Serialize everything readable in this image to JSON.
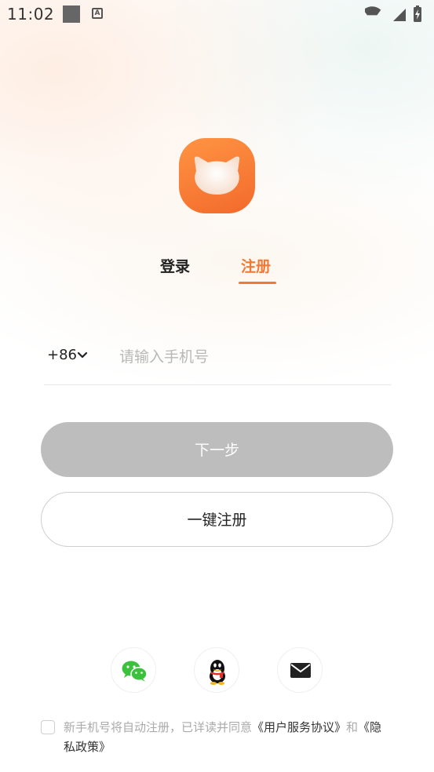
{
  "status_bar": {
    "time": "11:02",
    "icons": [
      "notification-square-icon",
      "a-notification-icon",
      "wifi-icon",
      "cell-signal-icon",
      "battery-charging-icon"
    ]
  },
  "logo": {
    "icon": "cat-head-icon",
    "color": "#f47a35"
  },
  "tabs": [
    {
      "label": "登录",
      "active": false
    },
    {
      "label": "注册",
      "active": true
    }
  ],
  "accent_color": "#f07a35",
  "phone": {
    "country_code": "+86",
    "placeholder": "请输入手机号",
    "value": ""
  },
  "buttons": {
    "next_label": "下一步",
    "one_key_register_label": "一键注册"
  },
  "social_login": [
    {
      "name": "wechat",
      "icon": "wechat-icon",
      "color": "#3cc13c"
    },
    {
      "name": "qq",
      "icon": "qq-penguin-icon",
      "color": "#111111"
    },
    {
      "name": "email",
      "icon": "mail-icon",
      "color": "#222222"
    }
  ],
  "agreement": {
    "checked": false,
    "text_prefix": "新手机号将自动注册，已详读并同意",
    "user_agreement": "《用户服务协议》",
    "and": "和",
    "privacy_policy": "《隐私政策》"
  }
}
